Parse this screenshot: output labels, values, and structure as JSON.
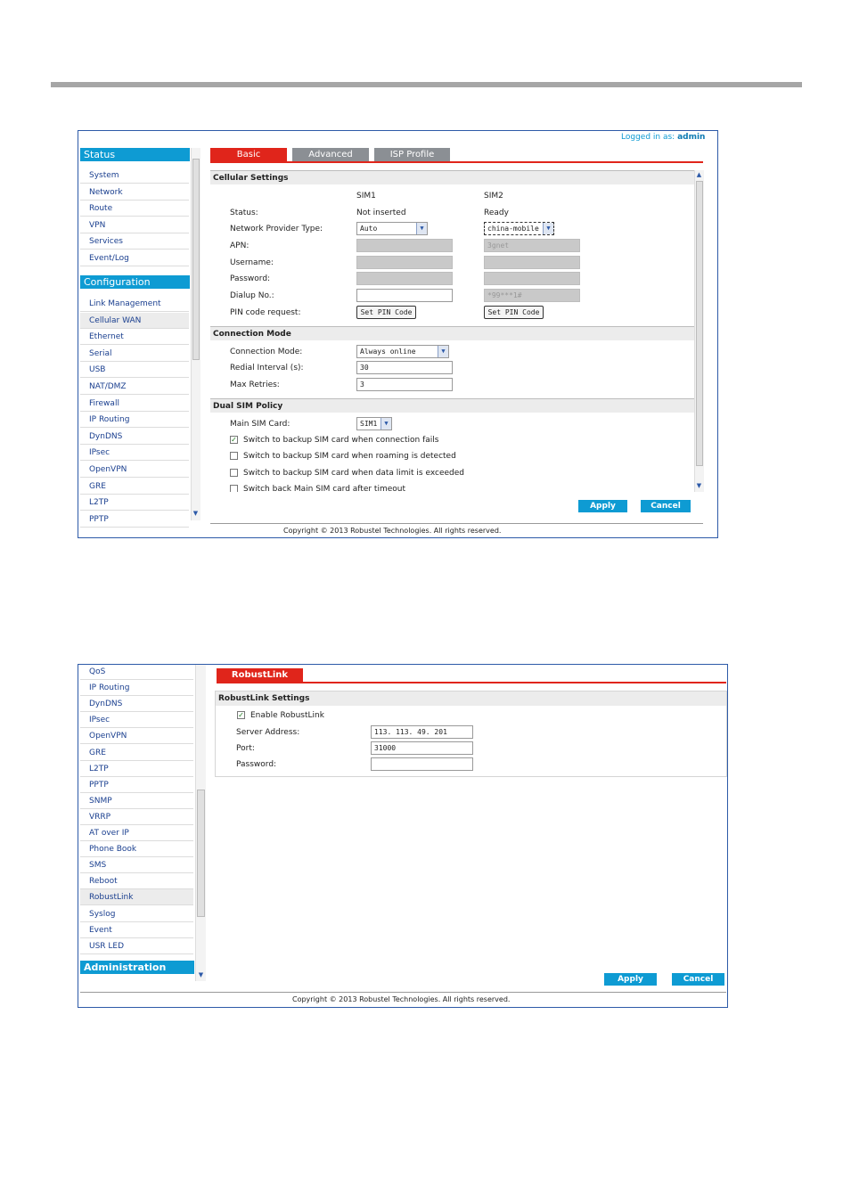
{
  "colors": {
    "accent_blue": "#0e9bd3",
    "tab_red": "#e0251b",
    "tab_grey": "#8b8f94",
    "frame_blue": "#2d5aa8"
  },
  "shot1": {
    "logged_in_label": "Logged in as:",
    "logged_in_user": "admin",
    "sidebar": {
      "status_header": "Status",
      "status_items": [
        "System",
        "Network",
        "Route",
        "VPN",
        "Services",
        "Event/Log"
      ],
      "config_header": "Configuration",
      "config_items": [
        "Link Management",
        "Cellular WAN",
        "Ethernet",
        "Serial",
        "USB",
        "NAT/DMZ",
        "Firewall",
        "IP Routing",
        "DynDNS",
        "IPsec",
        "OpenVPN",
        "GRE",
        "L2TP",
        "PPTP"
      ],
      "active_item": "Cellular WAN"
    },
    "tabs": [
      "Basic",
      "Advanced",
      "ISP Profile"
    ],
    "cellular": {
      "title": "Cellular Settings",
      "sim1_header": "SIM1",
      "sim2_header": "SIM2",
      "status_label": "Status:",
      "sim1_status": "Not inserted",
      "sim2_status": "Ready",
      "provider_label": "Network Provider Type:",
      "sim1_provider": "Auto",
      "sim2_provider": "china-mobile",
      "apn_label": "APN:",
      "sim2_apn": "3gnet",
      "username_label": "Username:",
      "password_label": "Password:",
      "dialup_label": "Dialup No.:",
      "sim2_dialup": "*99***1#",
      "pin_label": "PIN code request:",
      "pin_button": "Set PIN Code"
    },
    "connection": {
      "title": "Connection Mode",
      "mode_label": "Connection Mode:",
      "mode_value": "Always online",
      "redial_label": "Redial Interval (s):",
      "redial_value": "30",
      "retries_label": "Max Retries:",
      "retries_value": "3"
    },
    "dual_sim": {
      "title": "Dual SIM Policy",
      "main_label": "Main SIM Card:",
      "main_value": "SIM1",
      "opt1": "Switch to backup SIM card when connection fails",
      "opt2": "Switch to backup SIM card when roaming is detected",
      "opt3": "Switch to backup SIM card when data limit is exceeded",
      "opt4": "Switch back Main SIM card after timeout",
      "opt1_checked": true
    },
    "apply": "Apply",
    "cancel": "Cancel",
    "copyright": "Copyright © 2013 Robustel Technologies. All rights reserved."
  },
  "shot2": {
    "sidebar_items": [
      "QoS",
      "IP Routing",
      "DynDNS",
      "IPsec",
      "OpenVPN",
      "GRE",
      "L2TP",
      "PPTP",
      "SNMP",
      "VRRP",
      "AT over IP",
      "Phone Book",
      "SMS",
      "Reboot",
      "RobustLink",
      "Syslog",
      "Event",
      "USR LED"
    ],
    "active_item": "RobustLink",
    "admin_header": "Administration",
    "tab": "RobustLink",
    "settings_title": "RobustLink Settings",
    "enable_label": "Enable RobustLink",
    "enable_checked": true,
    "server_label": "Server Address:",
    "server_value": "113. 113. 49. 201",
    "port_label": "Port:",
    "port_value": "31000",
    "password_label": "Password:",
    "apply": "Apply",
    "cancel": "Cancel",
    "copyright": "Copyright © 2013 Robustel Technologies. All rights reserved."
  }
}
